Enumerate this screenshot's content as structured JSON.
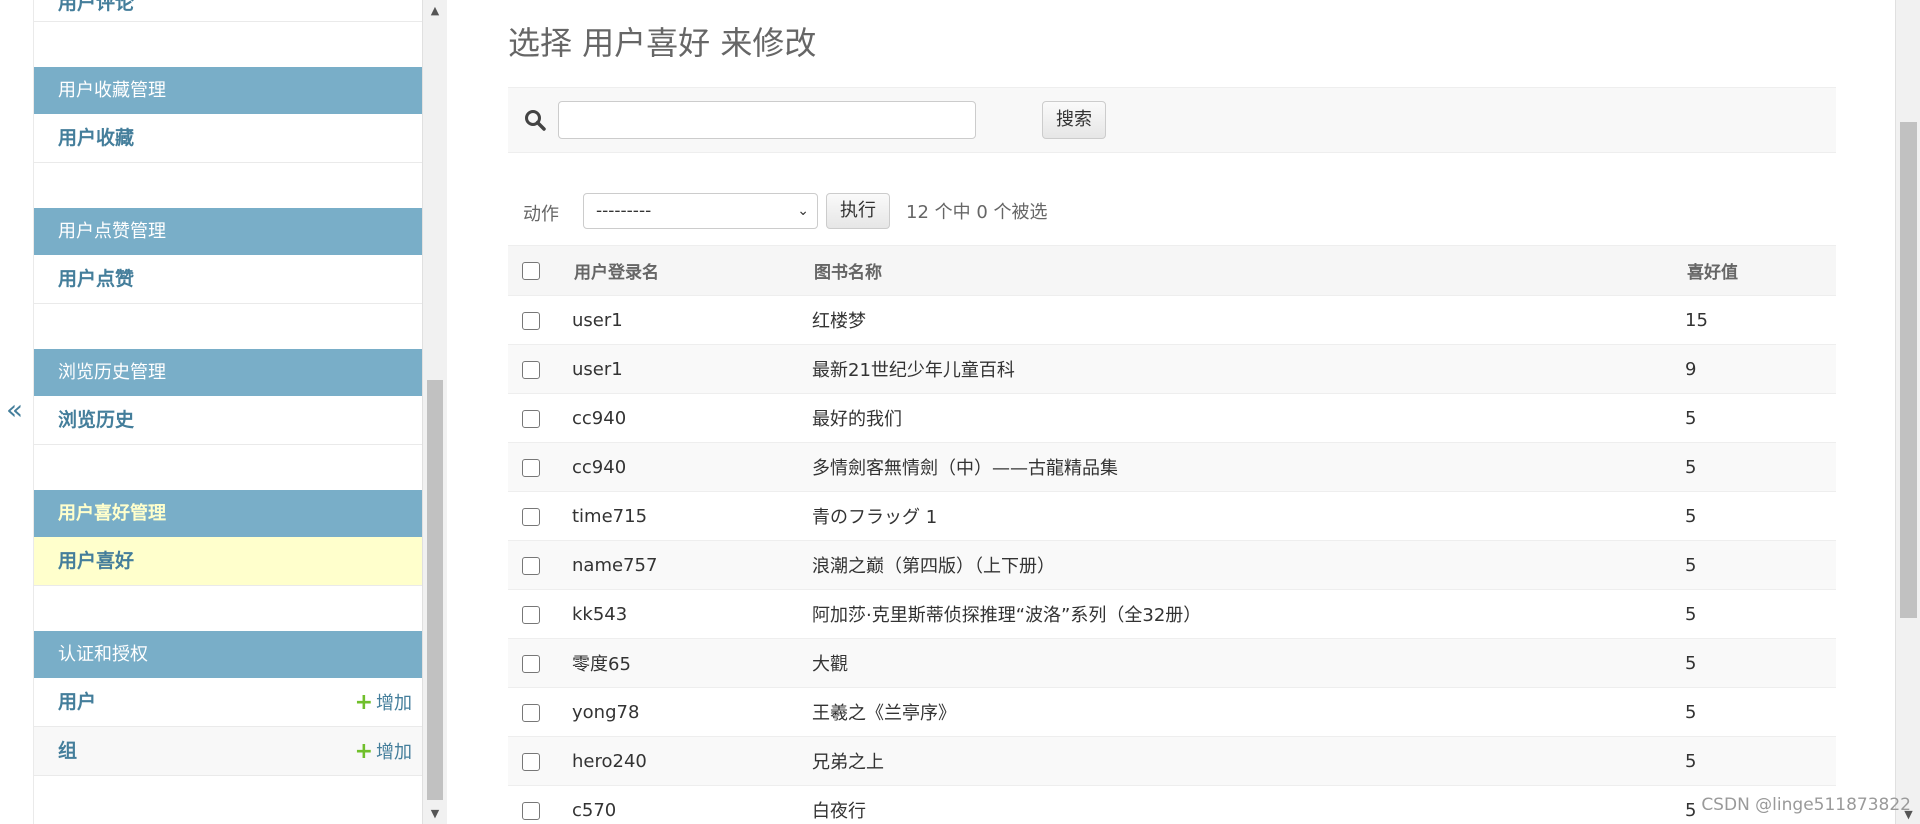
{
  "sidebar": {
    "collapse_label": "«",
    "top_partial_item": "用户评论",
    "modules": [
      {
        "caption": "用户收藏管理",
        "items": [
          {
            "label": "用户收藏"
          }
        ]
      },
      {
        "caption": "用户点赞管理",
        "items": [
          {
            "label": "用户点赞"
          }
        ]
      },
      {
        "caption": "浏览历史管理",
        "items": [
          {
            "label": "浏览历史"
          }
        ]
      },
      {
        "caption": "用户喜好管理",
        "items": [
          {
            "label": "用户喜好"
          }
        ]
      },
      {
        "caption": "认证和授权",
        "items": [
          {
            "label": "用户",
            "add_label": "增加"
          },
          {
            "label": "组",
            "add_label": "增加"
          }
        ]
      }
    ]
  },
  "main": {
    "title": "选择 用户喜好 来修改",
    "search": {
      "placeholder": "",
      "value": "",
      "button_label": "搜索"
    },
    "actions": {
      "label": "动作",
      "selected_option": "---------",
      "run_label": "执行",
      "selection_count": "12 个中 0 个被选"
    },
    "table": {
      "headers": [
        "用户登录名",
        "图书名称",
        "喜好值"
      ],
      "rows": [
        {
          "user": "user1",
          "book": "红楼梦",
          "value": "15"
        },
        {
          "user": "user1",
          "book": "最新21世纪少年儿童百科",
          "value": "9"
        },
        {
          "user": "cc940",
          "book": "最好的我们",
          "value": "5"
        },
        {
          "user": "cc940",
          "book": "多情劍客無情劍（中）——古龍精品集",
          "value": "5"
        },
        {
          "user": "time715",
          "book": "青のフラッグ 1",
          "value": "5"
        },
        {
          "user": "name757",
          "book": "浪潮之巅（第四版）（上下册）",
          "value": "5"
        },
        {
          "user": "kk543",
          "book": "阿加莎·克里斯蒂侦探推理“波洛”系列（全32册）",
          "value": "5"
        },
        {
          "user": "零度65",
          "book": "大觀",
          "value": "5"
        },
        {
          "user": "yong78",
          "book": "王羲之《兰亭序》",
          "value": "5"
        },
        {
          "user": "hero240",
          "book": "兄弟之上",
          "value": "5"
        },
        {
          "user": "c570",
          "book": "白夜行",
          "value": "5"
        }
      ]
    }
  },
  "watermark": "CSDN @linge511873822",
  "colors": {
    "caption_bg": "#79aec8",
    "link": "#447e9b",
    "selected_bg": "#ffffcc",
    "add_icon": "#70bf2b"
  }
}
